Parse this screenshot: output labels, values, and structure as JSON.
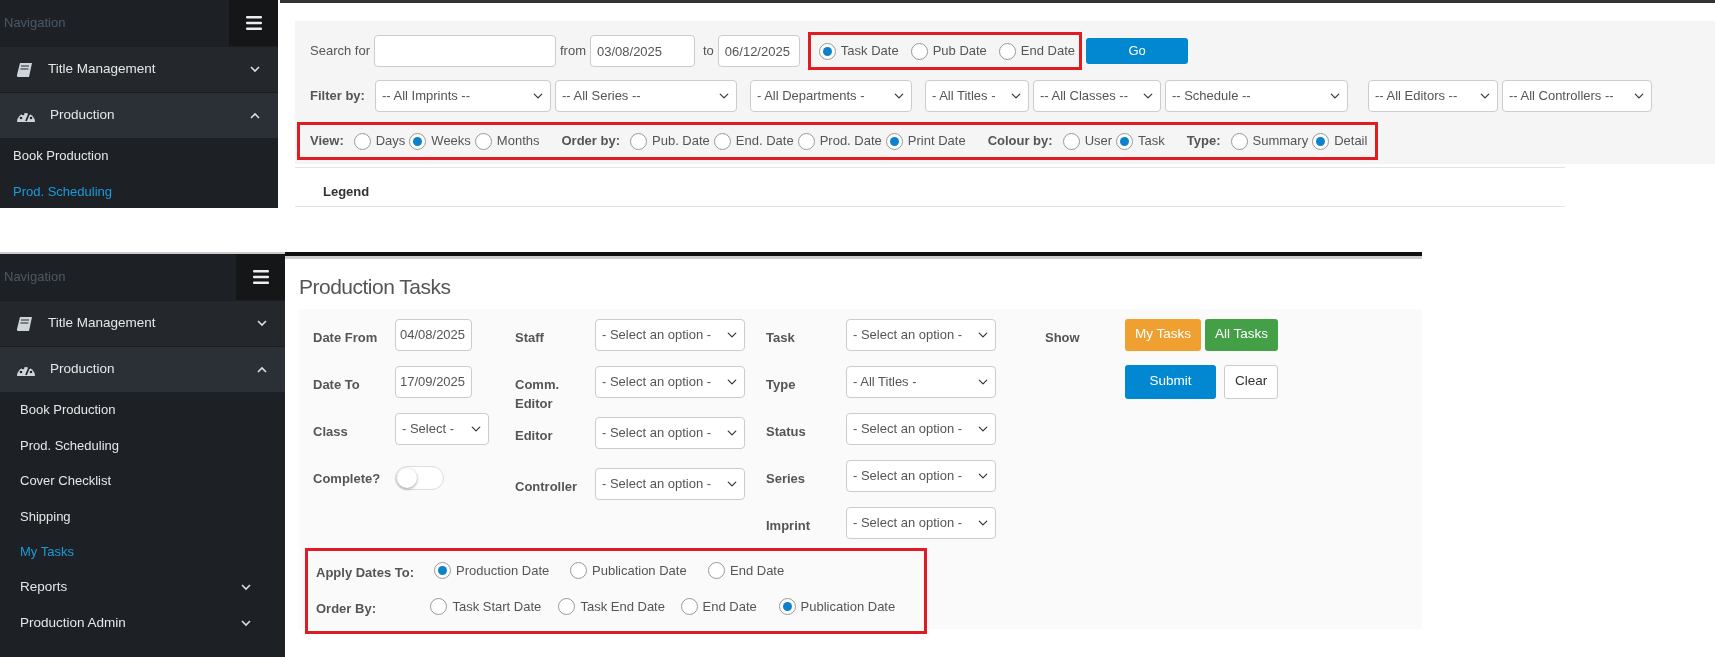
{
  "scheduling_screen": {
    "sidebar": {
      "header": "Navigation",
      "items": [
        {
          "kind": "group",
          "label": "Title Management",
          "expanded": false
        },
        {
          "kind": "group",
          "label": "Production",
          "expanded": true
        },
        {
          "kind": "link",
          "label": "Book Production",
          "selected": false
        },
        {
          "kind": "link",
          "label": "Prod. Scheduling",
          "selected": true
        }
      ]
    },
    "search": {
      "label": "Search for",
      "from_label": "from",
      "from_value": "03/08/2025",
      "to_label": "to",
      "to_value": "06/12/2025",
      "date_type": {
        "highlighted": true,
        "options": [
          {
            "label": "Task Date",
            "selected": true
          },
          {
            "label": "Pub Date",
            "selected": false
          },
          {
            "label": "End Date",
            "selected": false
          }
        ]
      },
      "go_button": "Go"
    },
    "filters": {
      "label": "Filter by:",
      "selects": [
        {
          "value": "-- All Imprints --"
        },
        {
          "value": "-- All Series --"
        },
        {
          "value": "- All Departments -"
        },
        {
          "value": "- All Titles -"
        },
        {
          "value": "-- All Classes --"
        },
        {
          "value": "-- Schedule --"
        },
        {
          "value": "-- All Editors --"
        },
        {
          "value": "-- All Controllers --"
        }
      ]
    },
    "view_options": {
      "highlighted": true,
      "groups": [
        {
          "label": "View:",
          "options": [
            {
              "label": "Days",
              "selected": false
            },
            {
              "label": "Weeks",
              "selected": true
            },
            {
              "label": "Months",
              "selected": false
            }
          ]
        },
        {
          "label": "Order by:",
          "options": [
            {
              "label": "Pub. Date",
              "selected": false
            },
            {
              "label": "End. Date",
              "selected": false
            },
            {
              "label": "Prod. Date",
              "selected": false
            },
            {
              "label": "Print Date",
              "selected": true
            }
          ]
        },
        {
          "label": "Colour by:",
          "options": [
            {
              "label": "User",
              "selected": false
            },
            {
              "label": "Task",
              "selected": true
            }
          ]
        },
        {
          "label": "Type:",
          "options": [
            {
              "label": "Summary",
              "selected": false
            },
            {
              "label": "Detail",
              "selected": true
            }
          ]
        }
      ]
    },
    "legend": "Legend"
  },
  "tasks_screen": {
    "sidebar": {
      "header": "Navigation",
      "items": [
        {
          "kind": "group",
          "label": "Title Management",
          "expanded": false
        },
        {
          "kind": "group",
          "label": "Production",
          "expanded": true
        },
        {
          "kind": "link",
          "label": "Book Production",
          "selected": false
        },
        {
          "kind": "link",
          "label": "Prod. Scheduling",
          "selected": false
        },
        {
          "kind": "link",
          "label": "Cover Checklist",
          "selected": false
        },
        {
          "kind": "link",
          "label": "Shipping",
          "selected": false
        },
        {
          "kind": "link",
          "label": "My Tasks",
          "selected": true
        },
        {
          "kind": "folder",
          "label": "Reports",
          "expanded": false
        },
        {
          "kind": "folder",
          "label": "Production Admin",
          "expanded": false
        }
      ]
    },
    "title": "Production Tasks",
    "field_columns": [
      [
        {
          "kind": "date",
          "label": "Date From",
          "value": "04/08/2025"
        },
        {
          "kind": "date",
          "label": "Date To",
          "value": "17/09/2025"
        },
        {
          "kind": "select",
          "label": "Class",
          "value": "- Select -"
        },
        {
          "kind": "switch",
          "label": "Complete?",
          "on": false
        }
      ],
      [
        {
          "kind": "select",
          "label": "Staff",
          "value": "- Select an option -"
        },
        {
          "kind": "select",
          "label": "Comm. Editor",
          "value": "- Select an option -"
        },
        {
          "kind": "select",
          "label": "Editor",
          "value": "- Select an option -"
        },
        {
          "kind": "select",
          "label": "Controller",
          "value": "- Select an option -"
        }
      ],
      [
        {
          "kind": "select",
          "label": "Task",
          "value": "- Select an option -"
        },
        {
          "kind": "select",
          "label": "Type",
          "value": "- All Titles -"
        },
        {
          "kind": "select",
          "label": "Status",
          "value": "- Select an option -"
        },
        {
          "kind": "select",
          "label": "Series",
          "value": "- Select an option -"
        },
        {
          "kind": "select",
          "label": "Imprint",
          "value": "- Select an option -"
        }
      ]
    ],
    "show": {
      "label": "Show",
      "buttons": [
        {
          "label": "My Tasks",
          "kind": "warning"
        },
        {
          "label": "All Tasks",
          "kind": "success"
        }
      ],
      "actions": [
        {
          "label": "Submit",
          "kind": "primary"
        },
        {
          "label": "Clear",
          "kind": "light"
        }
      ]
    },
    "date_options": {
      "highlighted": true,
      "groups": [
        {
          "label": "Apply Dates To:",
          "options": [
            {
              "label": "Production Date",
              "selected": true
            },
            {
              "label": "Publication Date",
              "selected": false
            },
            {
              "label": "End Date",
              "selected": false
            }
          ]
        },
        {
          "label": "Order By:",
          "options": [
            {
              "label": "Task Start Date",
              "selected": false
            },
            {
              "label": "Task End Date",
              "selected": false
            },
            {
              "label": "End Date",
              "selected": false
            },
            {
              "label": "Publication Date",
              "selected": true
            }
          ]
        }
      ]
    }
  }
}
